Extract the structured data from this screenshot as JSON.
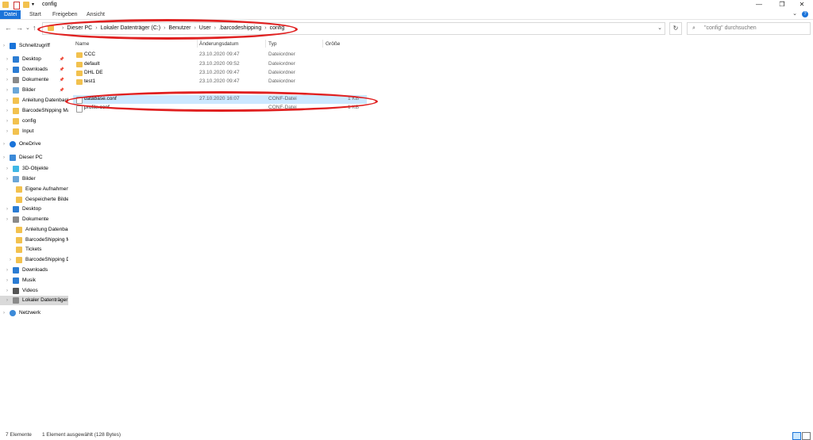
{
  "window": {
    "title": "config",
    "minimize_glyph": "—",
    "maximize_glyph": "❐",
    "close_glyph": "✕"
  },
  "ribbon": {
    "tabs": [
      {
        "label": "Datei",
        "active": true
      },
      {
        "label": "Start",
        "active": false
      },
      {
        "label": "Freigeben",
        "active": false
      },
      {
        "label": "Ansicht",
        "active": false
      }
    ],
    "collapse_glyph": "⌄",
    "help_glyph": "?"
  },
  "address_bar": {
    "crumbs": [
      "Dieser PC",
      "Lokaler Datenträger (C:)",
      "Benutzer",
      "User",
      ".barcodeshipping",
      "config"
    ],
    "separator": "›",
    "dropdown_glyph": "⌄",
    "refresh_glyph": "↻",
    "back_glyph": "←",
    "forward_glyph": "→",
    "recent_glyph": "⌄",
    "up_glyph": "↑"
  },
  "search": {
    "placeholder": "\"config\" durchsuchen",
    "icon_glyph": "⌕"
  },
  "sidebar": {
    "items": [
      {
        "label": "Schnellzugriff",
        "icon": "star-icon",
        "color": "#1a73d9",
        "indent": 0,
        "pinned": false
      },
      {
        "label": "Desktop",
        "icon": "desktop-icon",
        "color": "#2b7cd3",
        "indent": 1,
        "pinned": true
      },
      {
        "label": "Downloads",
        "icon": "download-icon",
        "color": "#2b7cd3",
        "indent": 1,
        "pinned": true
      },
      {
        "label": "Dokumente",
        "icon": "documents-icon",
        "color": "#8a8a8a",
        "indent": 1,
        "pinned": true
      },
      {
        "label": "Bilder",
        "icon": "pictures-icon",
        "color": "#6aa6d8",
        "indent": 1,
        "pinned": true
      },
      {
        "label": "Anleitung Datenbank",
        "icon": "folder-icon",
        "color": "#f2c14e",
        "indent": 1,
        "pinned": false
      },
      {
        "label": "BarcodeShipping Manual",
        "icon": "folder-icon",
        "color": "#f2c14e",
        "indent": 1,
        "pinned": false
      },
      {
        "label": "config",
        "icon": "folder-icon",
        "color": "#f2c14e",
        "indent": 1,
        "pinned": false
      },
      {
        "label": "Input",
        "icon": "folder-icon",
        "color": "#f2c14e",
        "indent": 1,
        "pinned": false
      },
      {
        "label": "OneDrive",
        "icon": "cloud-icon",
        "color": "#1a73d9",
        "indent": 0,
        "pinned": false
      },
      {
        "label": "Dieser PC",
        "icon": "computer-icon",
        "color": "#3c8ad8",
        "indent": 0,
        "pinned": false
      },
      {
        "label": "3D-Objekte",
        "icon": "cube-icon",
        "color": "#3fb7e5",
        "indent": 1,
        "pinned": false
      },
      {
        "label": "Bilder",
        "icon": "pictures-icon",
        "color": "#6aa6d8",
        "indent": 1,
        "pinned": false
      },
      {
        "label": "Eigene Aufnahmen",
        "icon": "folder-icon",
        "color": "#f2c14e",
        "indent": 2,
        "pinned": false
      },
      {
        "label": "Gespeicherte Bilder",
        "icon": "folder-icon",
        "color": "#f2c14e",
        "indent": 2,
        "pinned": false
      },
      {
        "label": "Desktop",
        "icon": "desktop-icon",
        "color": "#2b7cd3",
        "indent": 1,
        "pinned": false
      },
      {
        "label": "Dokumente",
        "icon": "documents-icon",
        "color": "#8a8a8a",
        "indent": 1,
        "pinned": false
      },
      {
        "label": "Anleitung Datenbank",
        "icon": "folder-icon",
        "color": "#f2c14e",
        "indent": 2,
        "pinned": false
      },
      {
        "label": "BarcodeShipping Manual",
        "icon": "folder-icon",
        "color": "#f2c14e",
        "indent": 2,
        "pinned": false
      },
      {
        "label": "Tickets",
        "icon": "folder-icon",
        "color": "#f2c14e",
        "indent": 2,
        "pinned": false
      },
      {
        "label": "BarcodeShipping Data",
        "icon": "folder-icon",
        "color": "#f2c14e",
        "indent": 2,
        "pinned": false
      },
      {
        "label": "Downloads",
        "icon": "download-icon",
        "color": "#2b7cd3",
        "indent": 1,
        "pinned": false
      },
      {
        "label": "Musik",
        "icon": "music-icon",
        "color": "#2b7cd3",
        "indent": 1,
        "pinned": false
      },
      {
        "label": "Videos",
        "icon": "video-icon",
        "color": "#555555",
        "indent": 1,
        "pinned": false
      },
      {
        "label": "Lokaler Datenträger (C:)",
        "icon": "drive-icon",
        "color": "#8a8a8a",
        "indent": 1,
        "pinned": false,
        "selected": true
      },
      {
        "label": "Netzwerk",
        "icon": "network-icon",
        "color": "#3c8ad8",
        "indent": 0,
        "pinned": false
      }
    ]
  },
  "file_list": {
    "columns": [
      "Name",
      "Änderungsdatum",
      "Typ",
      "Größe"
    ],
    "rows": [
      {
        "name": "CCC",
        "date": "23.10.2020 09:47",
        "type": "Dateiordner",
        "size": "",
        "kind": "folder",
        "selected": false
      },
      {
        "name": "default",
        "date": "23.10.2020 09:52",
        "type": "Dateiordner",
        "size": "",
        "kind": "folder",
        "selected": false
      },
      {
        "name": "DHL DE",
        "date": "23.10.2020 09:47",
        "type": "Dateiordner",
        "size": "",
        "kind": "folder",
        "selected": false
      },
      {
        "name": "test1",
        "date": "23.10.2020 09:47",
        "type": "Dateiordner",
        "size": "",
        "kind": "folder",
        "selected": false
      },
      {
        "name": "database.conf",
        "date": "27.10.2020 16:07",
        "type": "CONF-Datei",
        "size": "1 KB",
        "kind": "file",
        "selected": true
      },
      {
        "name": "profile.conf",
        "date": "",
        "type": "CONF-Datei",
        "size": "1 KB",
        "kind": "file",
        "selected": false
      }
    ]
  },
  "status_bar": {
    "count": "7 Elemente",
    "selection": "1 Element ausgewählt (128 Bytes)"
  }
}
